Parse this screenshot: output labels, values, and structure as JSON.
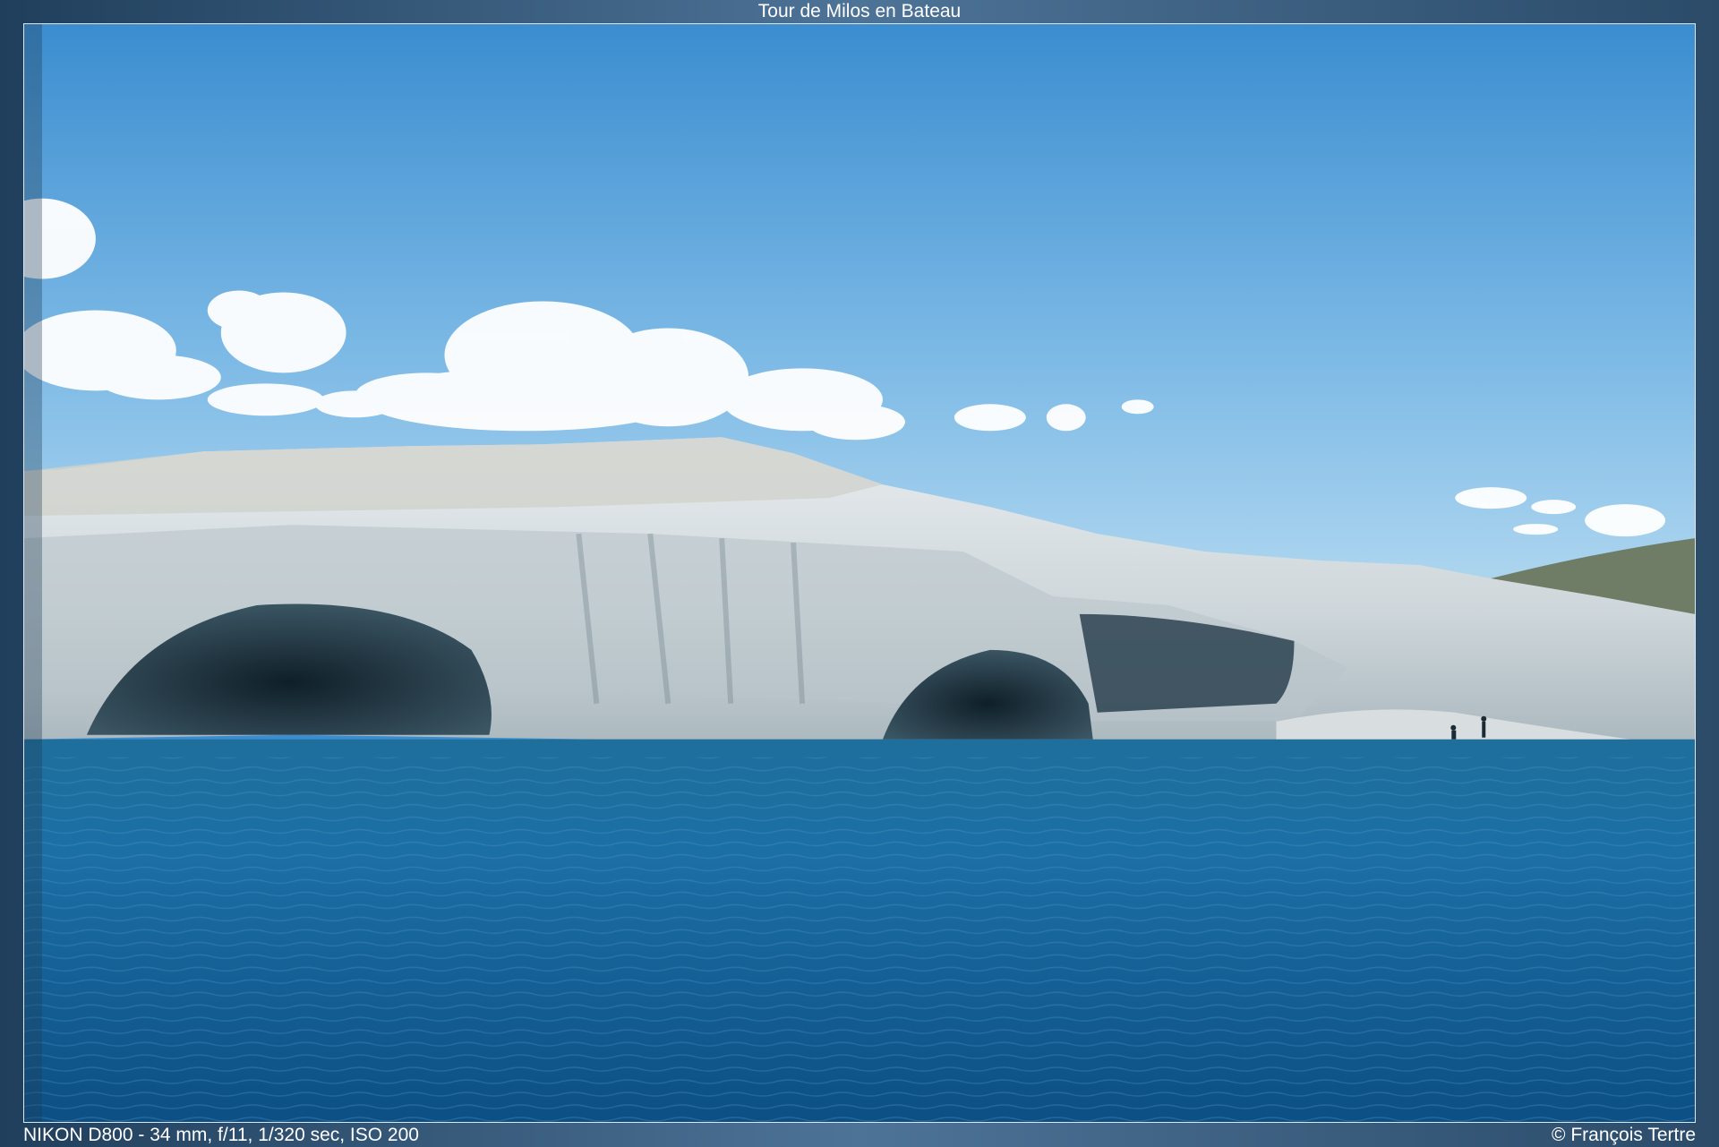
{
  "header": {
    "title": "Tour de Milos en Bateau"
  },
  "photo": {
    "subject": "seascape-white-cliffs-sea-caves",
    "colors": {
      "sky_top": "#3b8dd0",
      "sky_bottom": "#a9d3ef",
      "sea_top": "#1f78a8",
      "sea_bottom": "#0a4a7e",
      "cliff": "#d9e0e3",
      "cave_shadow": "#1e3340",
      "frame": "#2e4f6e"
    }
  },
  "footer": {
    "exif": "NIKON D800 - 34 mm, f/11, 1/320 sec, ISO 200",
    "credit": "© François Tertre"
  }
}
